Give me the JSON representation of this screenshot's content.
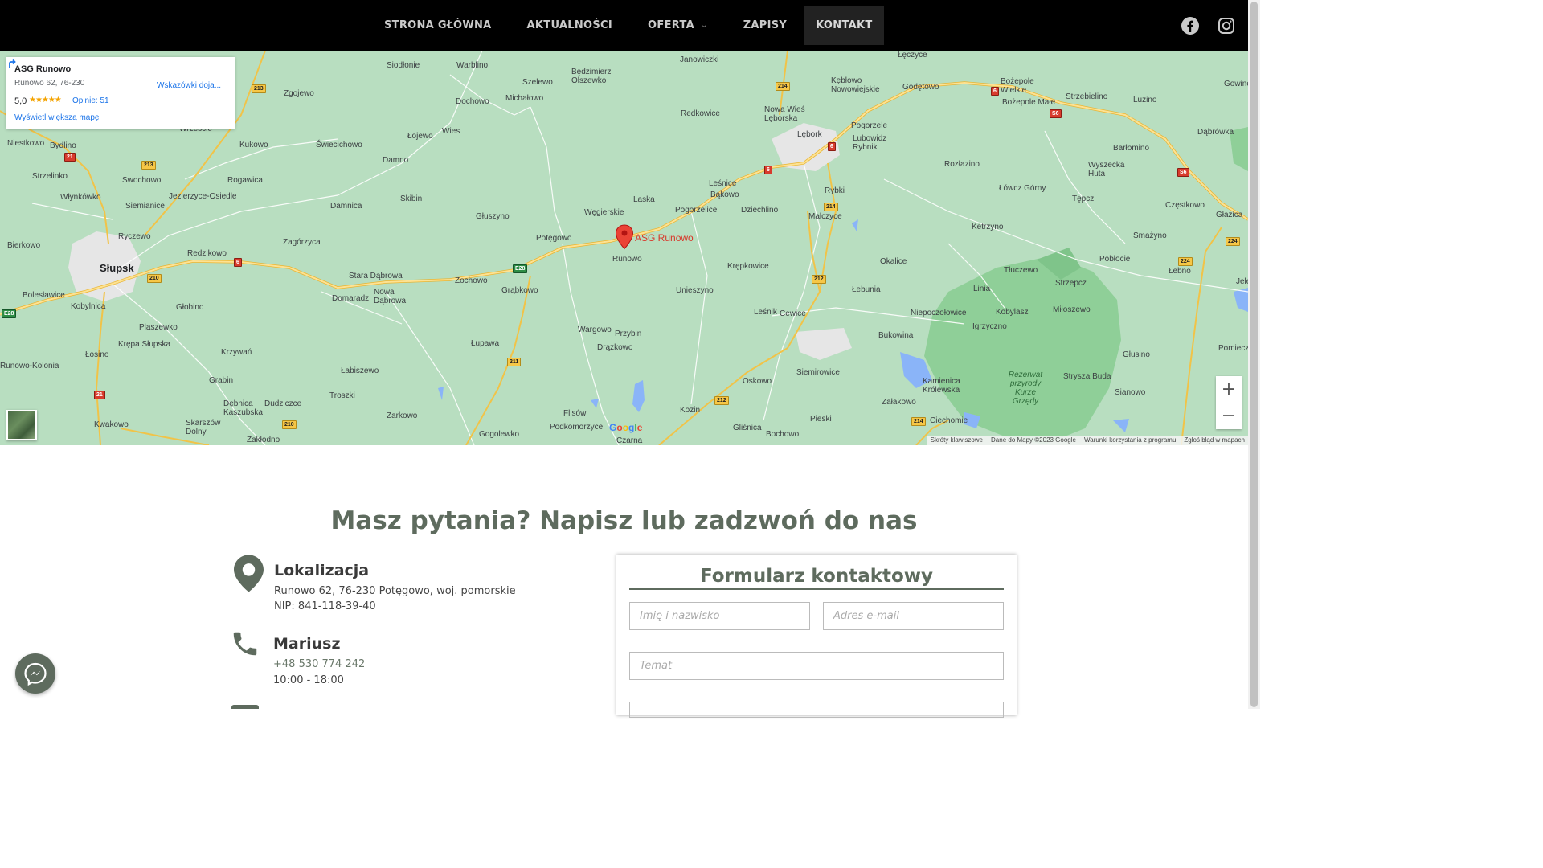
{
  "nav": {
    "items": [
      {
        "label": "STRONA GŁÓWNA",
        "active": false
      },
      {
        "label": "AKTUALNOŚCI",
        "active": false
      },
      {
        "label": "OFERTA",
        "active": false,
        "has_dropdown": true
      },
      {
        "label": "ZAPISY",
        "active": false
      },
      {
        "label": "KONTAKT",
        "active": true
      }
    ],
    "social": [
      "facebook-icon",
      "instagram-icon"
    ]
  },
  "map": {
    "card": {
      "title": "ASG Runowo",
      "address": "Runowo 62, 76-230",
      "rating": "5,0",
      "stars": "★★★★★",
      "reviews": "Opinie: 51",
      "directions": "Wskazówki doja...",
      "bigger_map": "Wyświetl większą mapę"
    },
    "pin_label": "ASG Runowo",
    "zoom_in": "+",
    "zoom_out": "−",
    "attribution": [
      "Skróty klawiszowe",
      "Dane do Mapy ©2023 Google",
      "Warunki korzystania z programu",
      "Zgłoś błąd w mapach"
    ],
    "places": {
      "p0": "Słupsk",
      "p1": "Siodłonie",
      "p2": "Warblino",
      "p3": "Janowiczki",
      "p4": "Będzimierz Olszewko",
      "p5": "Szelewo",
      "p6": "Dochowo",
      "p7": "Michałowo",
      "p8": "Zgojewo",
      "p9": "Redkowice",
      "p10": "Nowa Wieś Lęborska",
      "p11": "Kębłowo Nowowiejskie",
      "p12": "Lębork",
      "p13": "Pogorzele",
      "p14": "Lubowidz Rybnik",
      "p15": "Godętowo",
      "p16": "Łęczyce",
      "p17": "Bożepole Wielkie",
      "p18": "Bożepole Małe",
      "p19": "Strzebielino",
      "p20": "Luzino",
      "p21": "Dąbrówka",
      "p22": "Barłomino",
      "p23": "Wyszecka Huta",
      "p24": "Rozłazino",
      "p25": "Łówcz Górny",
      "p26": "Tępcz",
      "p27": "Częstkowo",
      "p28": "Głazica",
      "p29": "Niestkowo",
      "p30": "Bydlino",
      "p31": "Wrzeście",
      "p32": "Kukowo",
      "p33": "Świecichowo",
      "p34": "Łojewo",
      "p35": "Wies",
      "p36": "Damno",
      "p37": "Strzelinko",
      "p38": "Swochowo",
      "p39": "Rogawica",
      "p40": "Włynkówko",
      "p41": "Jezierzyce-Osiedle",
      "p42": "Siemianice",
      "p43": "Skibin",
      "p44": "Damnica",
      "p45": "Głuszyno",
      "p46": "Węgierskie",
      "p47": "Laska",
      "p48": "Leśnice",
      "p49": "Bąkowo",
      "p50": "Pogorzelice",
      "p51": "Dziechlino",
      "p52": "Rybki",
      "p53": "Malczyce",
      "p54": "Ketrzyno",
      "p55": "Smażyno",
      "p56": "Ryczewo",
      "p57": "Bierkowo",
      "p58": "Zagórzyca",
      "p59": "Redzikowo",
      "p60": "Potęgowo",
      "p61": "Runowo",
      "p62": "Okalice",
      "p63": "Pobłocie",
      "p64": "Łebno",
      "p65": "Stara Dąbrowa",
      "p66": "Nowa Dąbrowa",
      "p67": "Domaradz",
      "p68": "Żochowo",
      "p69": "Grąbkowo",
      "p70": "Unieszyno",
      "p71": "Krępkowice",
      "p72": "Łebunia",
      "p73": "Linia",
      "p74": "Tłuczewo",
      "p75": "Strzepcz",
      "p76": "Bolesławice",
      "p77": "Kobylnica",
      "p78": "Głobino",
      "p79": "Leśnik",
      "p80": "Cewice",
      "p81": "Niepoczołowice",
      "p82": "Kobylasz",
      "p83": "Miłoszewo",
      "p84": "Igrzyczno",
      "p85": "Plaszewko",
      "p86": "Krępa Słupska",
      "p87": "Wargowo",
      "p88": "Przybin",
      "p89": "Drążkowo",
      "p90": "Łupawa",
      "p91": "Bukowina",
      "p92": "Głusino",
      "p93": "Łosino",
      "p94": "Krzywań",
      "p95": "Łabiszewo",
      "p96": "Siemirowice",
      "p97": "Kamienica Królewska",
      "p98": "Strysza Buda",
      "p99": "Grabin",
      "p100": "Oskowo",
      "p101": "Załakowo",
      "p102": "Sianowo",
      "p103": "Dębnica Kaszubska",
      "p104": "Dudziczce",
      "p105": "Troszki",
      "p106": "Żarkowo",
      "p107": "Flisów",
      "p108": "Kozin",
      "p109": "Pieski",
      "p110": "Ciechomie",
      "p111": "Kwakowo",
      "p112": "Skarszów Dolny",
      "p113": "Gogolewko",
      "p114": "Podkomorzyce",
      "p115": "Czarna",
      "p116": "Gliśnica",
      "p117": "Bochowo",
      "p118": "Zakłodno",
      "p119": "Rezerwat przyrody Kurze Grzędy",
      "p120": "Runowo-Kolonia",
      "p121": "Pomiecz",
      "p122": "Jeleń",
      "p123": "Gowino"
    },
    "roads": {
      "r0": "213",
      "r1": "21",
      "r2": "213",
      "r3": "214",
      "r4": "6",
      "r5": "6",
      "r6": "S6",
      "r7": "6",
      "r8": "214",
      "r9": "S6",
      "r10": "224",
      "r11": "224",
      "r12": "210",
      "r13": "6",
      "r14": "E28",
      "r15": "212",
      "r16": "E28",
      "r17": "21",
      "r18": "211",
      "r19": "212",
      "r20": "210",
      "r21": "214"
    },
    "google_logo": "Google"
  },
  "contact": {
    "title": "Masz pytania? Napisz lub zadzwoń do nas",
    "location": {
      "heading": "Lokalizacja",
      "address": "Runowo 62, 76-230 Potęgowo, woj. pomorskie",
      "nip": "NIP: 841-118-39-40"
    },
    "person": {
      "heading": "Mariusz",
      "phone": "+48 530 774 242",
      "hours": "10:00 - 18:00"
    }
  },
  "form": {
    "title": "Formularz kontaktowy",
    "name_placeholder": "Imię i nazwisko",
    "email_placeholder": "Adres e-mail",
    "subject_placeholder": "Temat"
  },
  "colors": {
    "accent": "#5e6b5e",
    "nav_bg": "#000000",
    "map_bg": "#b8dec0",
    "pin": "#d8372a",
    "link": "#1a73e8"
  }
}
